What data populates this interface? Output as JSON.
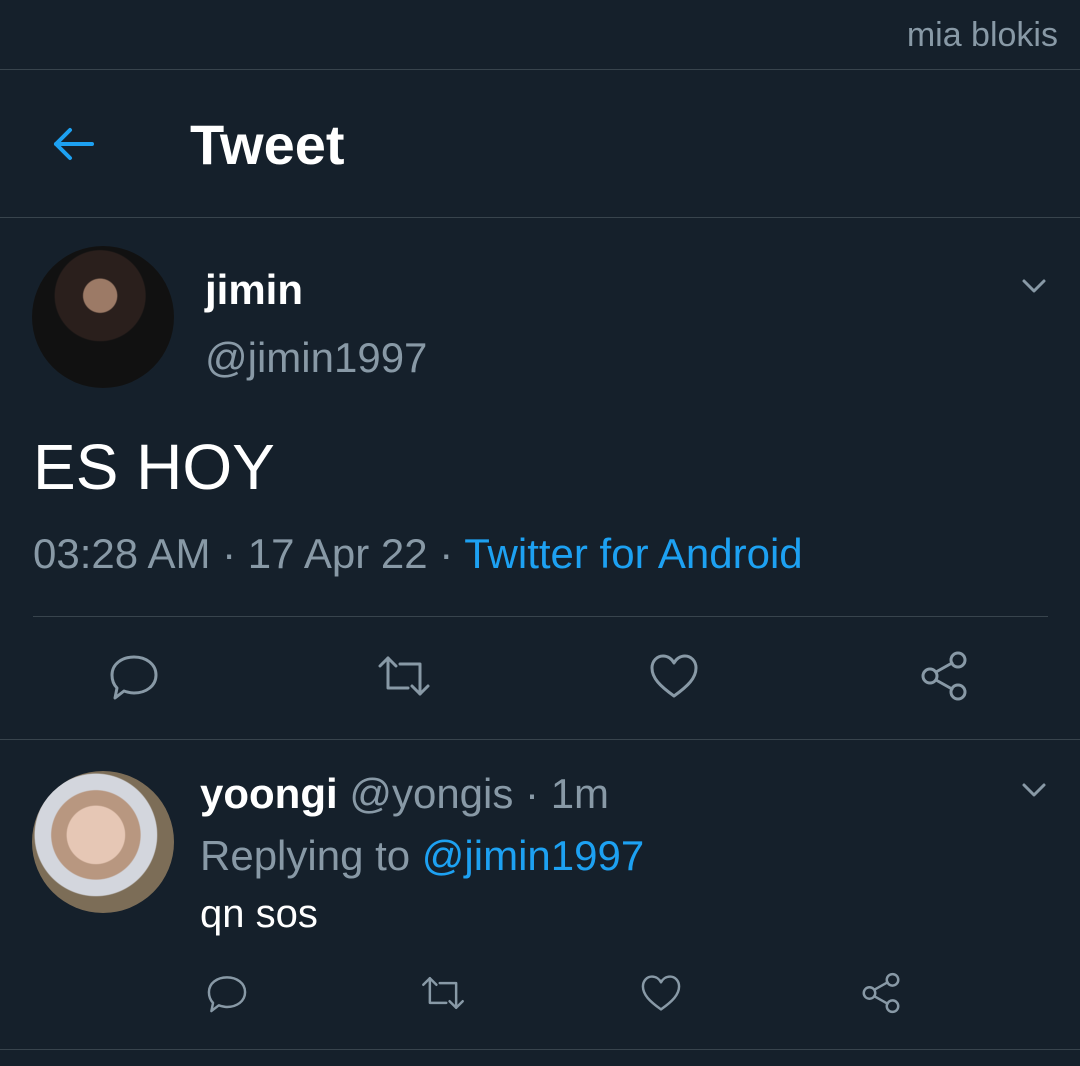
{
  "watermark": "mia blokis",
  "header": {
    "title": "Tweet"
  },
  "main_tweet": {
    "name": "jimin",
    "handle": "@jimin1997",
    "text": "ES HOY",
    "time": "03:28 AM",
    "separator": " · ",
    "date": "17 Apr 22",
    "source": "Twitter for Android"
  },
  "reply": {
    "name": "yoongi",
    "handle": "@yongis",
    "dot": " · ",
    "age": "1m",
    "replying_prefix": "Replying to ",
    "replying_to": "@jimin1997",
    "text": "qn sos"
  },
  "colors": {
    "background": "#15202b",
    "accent": "#1da1f2",
    "muted": "#8899a6",
    "divider": "#38444d"
  },
  "icons": [
    "back-arrow-icon",
    "chevron-down-icon",
    "reply-icon",
    "retweet-icon",
    "like-icon",
    "share-icon"
  ]
}
